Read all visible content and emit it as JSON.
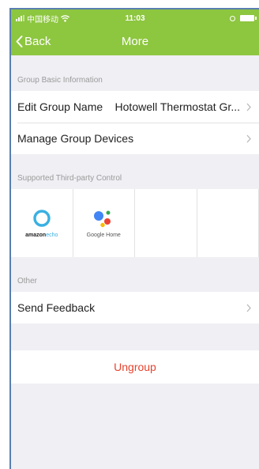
{
  "status_bar": {
    "carrier": "中国移动",
    "time": "11:03"
  },
  "nav": {
    "back_label": "Back",
    "title": "More"
  },
  "sections": {
    "basic_info": {
      "header": "Group Basic Information",
      "edit_name": {
        "label": "Edit Group Name",
        "value": "Hotowell Thermostat Gr..."
      },
      "manage_devices": {
        "label": "Manage Group Devices"
      }
    },
    "third_party": {
      "header": "Supported Third-party Control",
      "items": [
        {
          "brand": "amazon",
          "product": "echo"
        },
        {
          "caption": "Google Home"
        }
      ]
    },
    "other": {
      "header": "Other",
      "send_feedback": {
        "label": "Send Feedback"
      }
    }
  },
  "ungroup": {
    "label": "Ungroup"
  },
  "colors": {
    "header_green": "#8dc63f",
    "page_bg": "#efeff4",
    "destructive_red": "#e8432e",
    "echo_blue": "#3ab0e2",
    "google_blue": "#4285f4",
    "google_red": "#ea4335",
    "google_yellow": "#fbbc05",
    "google_green": "#34a853"
  },
  "icons": [
    "wifi-icon",
    "signal-icon",
    "battery-icon",
    "chevron-left-icon",
    "chevron-right-icon",
    "amazon-echo-logo",
    "google-home-logo"
  ]
}
